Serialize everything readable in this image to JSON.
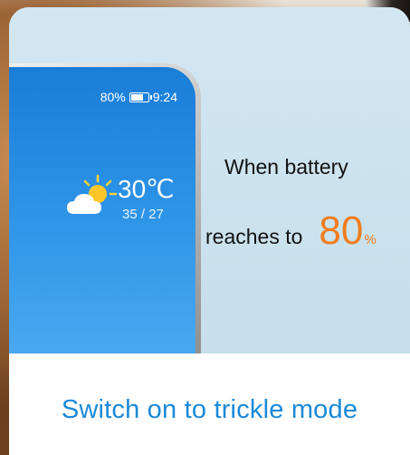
{
  "phone": {
    "battery_percent": "80%",
    "time": "9:24",
    "battery_level": 0.8,
    "weather_icon": "partly-cloudy-icon",
    "temperature": "30℃",
    "temp_range": "35 / 27"
  },
  "message": {
    "line1": "When battery",
    "line2": "reaches to",
    "threshold_value": "80",
    "threshold_unit": "%"
  },
  "caption": "Switch on to trickle mode",
  "colors": {
    "caption": "#1a8ad8",
    "accent": "#f07d1e",
    "card_top": "#cde3ee",
    "phone_screen": "#1a7dd8"
  }
}
